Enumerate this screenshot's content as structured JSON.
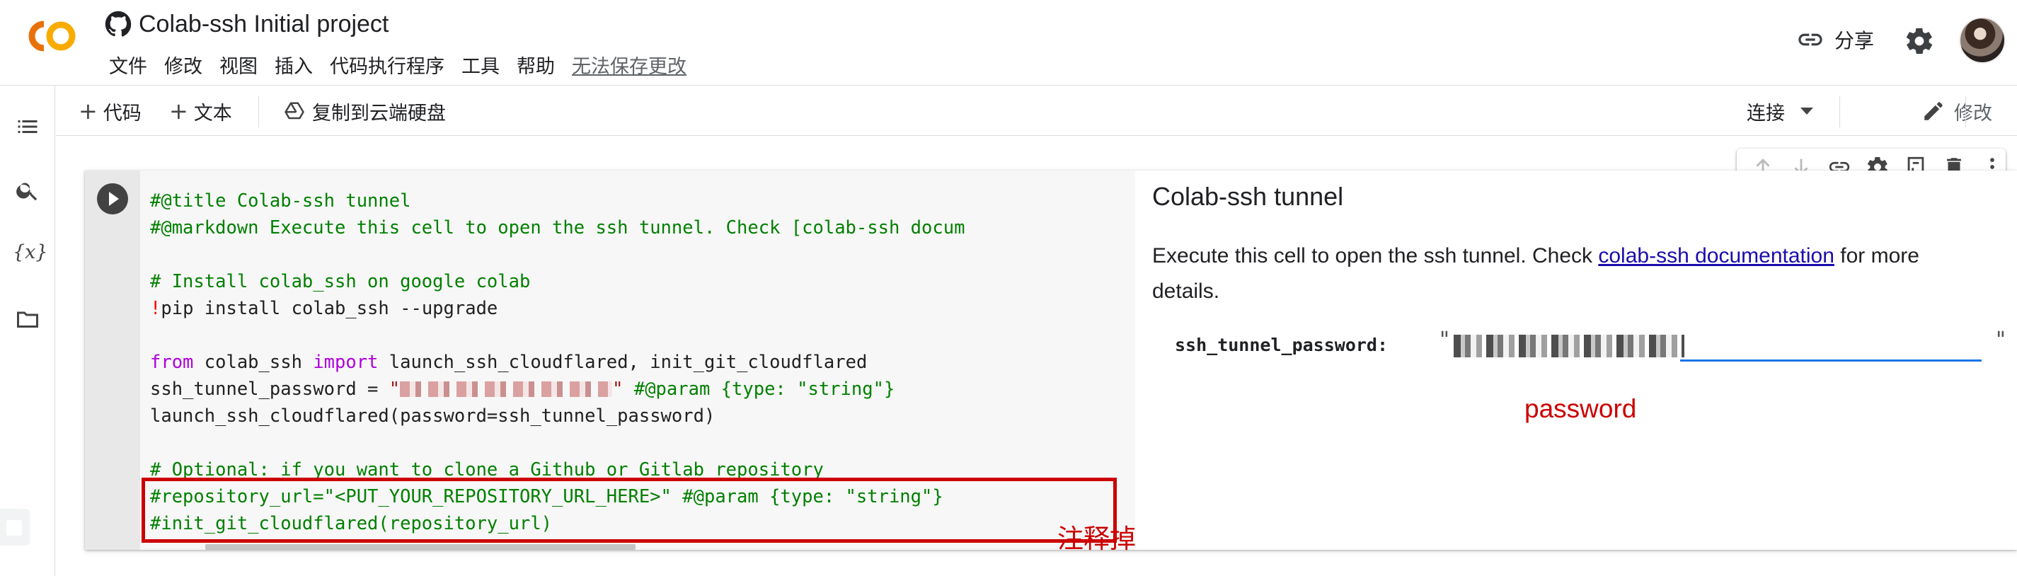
{
  "app": {
    "doc_title": "Colab-ssh Initial project",
    "brand": "CO"
  },
  "menu": [
    "文件",
    "修改",
    "视图",
    "插入",
    "代码执行程序",
    "工具",
    "帮助",
    "无法保存更改"
  ],
  "header_actions": {
    "share_label": "分享"
  },
  "toolbar": {
    "add_code": "代码",
    "add_text": "文本",
    "copy_to_drive": "复制到云端硬盘",
    "connect": "连接",
    "edit": "修改"
  },
  "icons": {
    "rail": [
      "toc-icon",
      "search-icon",
      "variables-icon",
      "folder-icon"
    ],
    "cell_tools": [
      "arrow-up-icon",
      "arrow-down-icon",
      "link-icon",
      "gear-icon",
      "mirror-cell-icon",
      "delete-icon",
      "more-vert-icon"
    ]
  },
  "cell": {
    "code_lines": [
      "#@title Colab-ssh tunnel",
      "#@markdown Execute this cell to open the ssh tunnel. Check [colab-ssh docum",
      "",
      "# Install colab_ssh on google colab",
      "!pip install colab_ssh --upgrade",
      "",
      "from colab_ssh import launch_ssh_cloudflared, init_git_cloudflared",
      "ssh_tunnel_password = \"",
      "\" #@param {type: \"string\"}",
      "launch_ssh_cloudflared(password=ssh_tunnel_password)",
      "",
      "# Optional: if you want to clone a Github or Gitlab repository",
      "#repository_url=\"<PUT_YOUR_REPOSITORY_URL_HERE>\" #@param {type: \"string\"}",
      "#init_git_cloudflared(repository_url)"
    ],
    "form_title": "Colab-ssh tunnel",
    "desc_before": "Execute this cell to open the ssh tunnel. Check ",
    "desc_link": "colab-ssh documentation",
    "desc_after": " for more details.",
    "param_label": "ssh_tunnel_password:",
    "param_quote_left": "\"",
    "param_quote_right": "\""
  },
  "annotations": {
    "comment_out": "注释掉",
    "password": "password"
  },
  "colors": {
    "accent": "#1a73e8",
    "annotation": "#cc0000",
    "comment": "#008000",
    "keyword": "#af00db",
    "string": "#a31515"
  }
}
